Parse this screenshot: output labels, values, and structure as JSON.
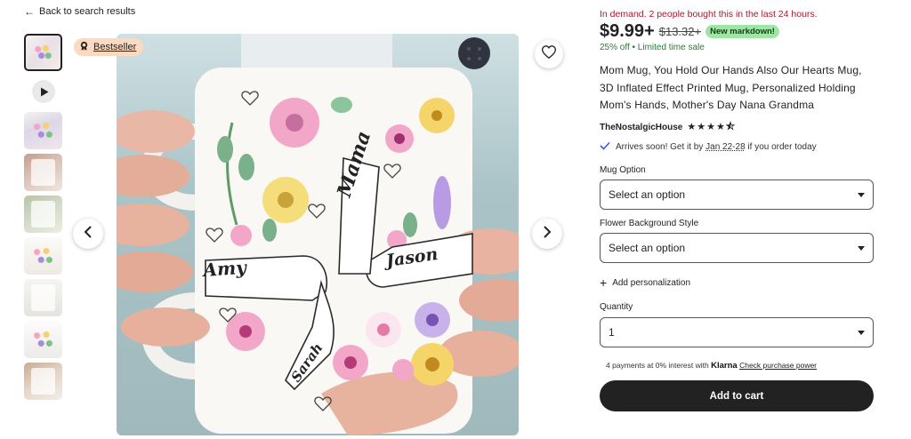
{
  "nav": {
    "back_label": "Back to search results"
  },
  "gallery": {
    "badge_label": "Bestseller",
    "mug_texts": {
      "top_name": "Mama",
      "left_name": "Amy",
      "right_name": "Jason",
      "bottom_name": "Sarah"
    }
  },
  "listing": {
    "demand_text": "In demand. 2 people bought this in the last 24 hours.",
    "price": "$9.99+",
    "original_price": "$13.32+",
    "markdown_badge": "New markdown!",
    "sale_text": "25% off  •  Limited time sale",
    "title": "Mom Mug, You Hold Our Hands Also Our Hearts Mug, 3D Inflated Effect Printed Mug, Personalized Holding Mom's Hands, Mother's Day Nana Grandma",
    "shop_name": "TheNostalgicHouse",
    "rating_stars": "★★★★⯪",
    "arrival": {
      "prefix": "Arrives soon! Get it by ",
      "dates": "Jan 22-28",
      "suffix": " if you order today"
    }
  },
  "options": {
    "mug_label": "Mug Option",
    "mug_value": "Select an option",
    "flower_label": "Flower Background Style",
    "flower_value": "Select an option",
    "personalization_label": "Add personalization",
    "quantity_label": "Quantity",
    "quantity_value": "1"
  },
  "payment": {
    "klarna_prefix": "4 payments at 0% interest with ",
    "klarna_brand": "Klarna",
    "klarna_link": "Check purchase power"
  },
  "cart": {
    "button_label": "Add to cart"
  },
  "colors": {
    "accent_red": "#a61a2e",
    "sale_green": "#2b7a3a",
    "badge_green": "#9ee6a3",
    "badge_peach": "#fcd9bf",
    "button_dark": "#222222"
  }
}
